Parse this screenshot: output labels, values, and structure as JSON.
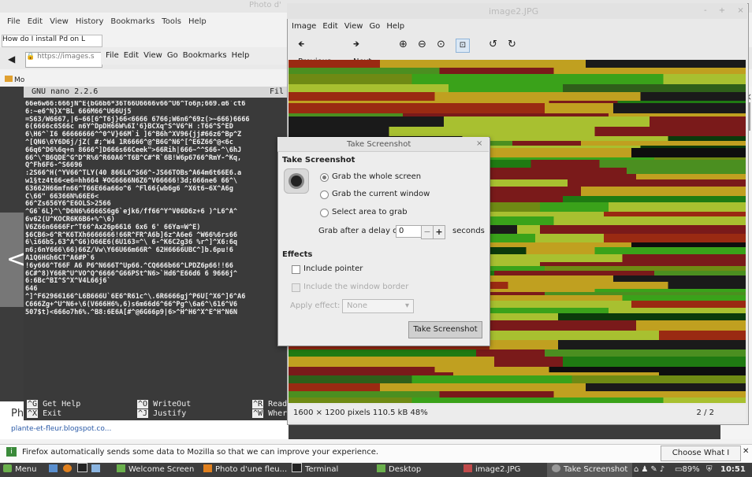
{
  "firefox": {
    "title": "Photo d'",
    "menu": [
      "File",
      "Edit",
      "View",
      "History",
      "Bookmarks",
      "Tools",
      "Help"
    ],
    "tab_label": "How do I install Pd on L",
    "url": "https://images.s",
    "bookmark": "Mo",
    "pin_text": "Ph",
    "pin_link": "plante-et-fleur.blogspot.co...",
    "notification": "Firefox automatically sends some data to Mozilla so that we can improve your experience.",
    "choose_button": "Choose What I Share",
    "prev_glyph": "<",
    "close_glyph": "×"
  },
  "second_window_menu": [
    "File",
    "Edit",
    "View",
    "Go",
    "Bookmarks",
    "Help"
  ],
  "nano": {
    "title": "GNU nano 2.2.6",
    "file_label": "Fil",
    "lines": [
      "66е6w66:666jN^E{bG6b6*36T66U6666v66^U6^To6ɲ;669.ɑ6`ct6",
      "6:~e6^N}X^BL 666M66^U66Uj5",
      "=S63/W6667,|6~66[6^T6j}66<6666 6766;W6n6^69z(>~666)6666",
      "6(6666c6S66c n6Y^DpDH66W%6I'6}BCXq^S^V6^H :T66^S^ED",
      "6\\H6^`I6 66666666^^0^V}66M`i ]6^B6h^XV96{jj#66z6^Bp^Z",
      "^[QN6\\6Y6D6j/jZ( #;^W4  1R6666^@^B6G^N6^[^E6Z66^@<6c",
      "66q6^D6%6q+n 8666^]D666s66Ceek\">66Rih|666~^^S66-^\\6hJ",
      "66^\\^B6QDE^G^D^R%6^R60A6^T6B^C#^R`6B!W6p6766^RmY-^Kq,",
      "Q^Fh6F6-^S6696",
      ":2S66^H(^YV66^TLY(40 866L6^S66^-JS66TOBs^A64m6t66E6.a",
      "w1§tz4t66<e6=hh664 ¥OG6666N6Z6^V66666!3d;666ne6 66^\\",
      "63662H66mfn66^T66E66a66o^6 ^Fl66{wb6g6 ^X6t6~6X^A6g",
      "C\\66\" 66366N%66E6<",
      "66^Zs656Y6^E6OLS>2566",
      "^G6`6L}^\\^D6N6%6666S6g6`ejk6/ff66^Y^V06D6z+6 )^L6^A^",
      "6v62(U^KOCR6K6B6+%^\\6)",
      "V6Z66n6666Fr^T66^Ax26p6616        6x6       6' 66Ya=W^E)",
      "$6CB6>6^R^K6TXh6666666!66R^FR^A6b]6z^A6e6 ^W66%6rs66",
      "6\\i66bS,63^A^G6)O66E6(6U163=^\\ 6-^K6C2g36 %r^]^X6:6q",
      "n6;6nY666\\66)66Z/Vw\\Y66U66m66R^ 62H6666UBC^]b.6pu!6",
      "A1Q6HGh6CT^A6#P`6",
      "!6y666^T66F A6  P6^N666T^Up66.^CQ666b66^LPDZ6p66!!66",
      "6C#^8)Y66R^U^VO^Q^6666^G66PSt^N6>`Hd6^E66d6 6 9666j^",
      "6:6Bc^BI^S^X^V4L66j6`",
      "646",
      "^]^F62966166^L6B666U`6E6^R61c^\\.6R6666gj^P6U[^X6^]6^A6",
      "C666Zg+^U^N6+\\6(V666H6%,6)s6m66d6^66^Pg^\\6a6^\\616^V6",
      "507$t)<666o7h6%.^B8:6E6A[#^@6G66p9|6>^H^H6^X^E^H^N6N"
    ],
    "help": [
      {
        "key": "^G",
        "label": "Get Help"
      },
      {
        "key": "^X",
        "label": "Exit"
      },
      {
        "key": "^O",
        "label": "WriteOut"
      },
      {
        "key": "^J",
        "label": "Justify"
      },
      {
        "key": "^R",
        "label": "Read"
      },
      {
        "key": "^W",
        "label": "Wher"
      }
    ]
  },
  "image_viewer": {
    "title": "image2.JPG",
    "window_controls": "- + ×",
    "menu": [
      "Image",
      "Edit",
      "View",
      "Go",
      "Help"
    ],
    "toolbar": {
      "previous": "Previous",
      "next": "Next"
    },
    "status_info": "1600 × 1200 pixels  110.5 kB  48%",
    "status_page": "2 / 2"
  },
  "dialog": {
    "title": "Take Screenshot",
    "close": "×",
    "section_take": "Take Screenshot",
    "opt_whole": "Grab the whole screen",
    "opt_window": "Grab the current window",
    "opt_area": "Select area to grab",
    "delay_label": "Grab after a delay of",
    "delay_value": "0",
    "delay_unit": "seconds",
    "minus": "−",
    "plus": "+",
    "section_effects": "Effects",
    "include_pointer": "Include pointer",
    "include_border": "Include the window border",
    "apply_effect_label": "Apply effect:",
    "apply_effect_value": "None",
    "button": "Take Screenshot"
  },
  "taskbar": {
    "menu": "Menu",
    "items": [
      "Welcome Screen",
      "Photo d'une fleu...",
      "Terminal",
      "Desktop",
      "image2.JPG",
      "Take Screenshot"
    ],
    "battery": "89%",
    "time": "10:51"
  }
}
